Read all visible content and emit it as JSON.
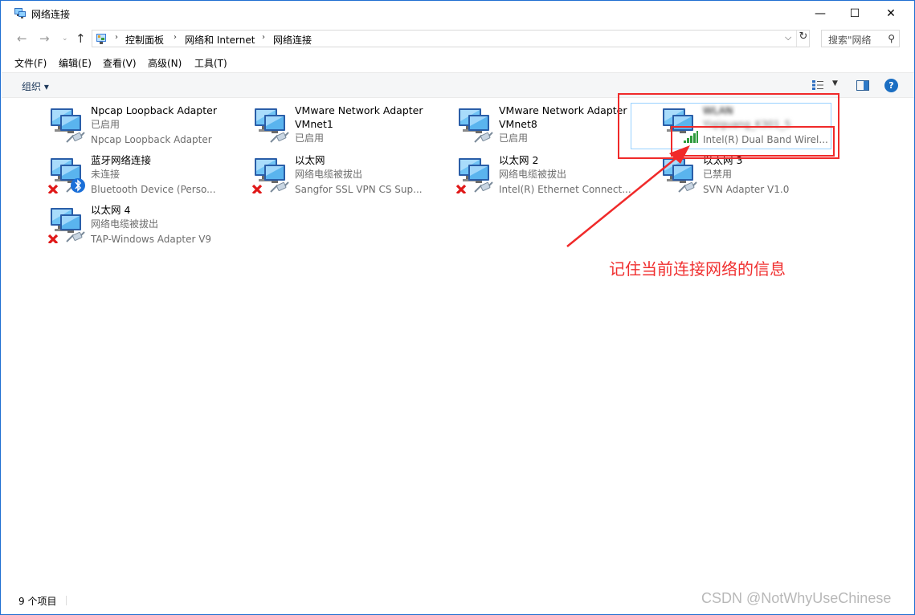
{
  "window": {
    "title": "网络连接"
  },
  "window_controls": {
    "minimize": "—",
    "maximize": "☐",
    "close": "✕"
  },
  "nav": {
    "back": "←",
    "forward": "→",
    "recent": "⌄",
    "up": "↑"
  },
  "breadcrumb": [
    "控制面板",
    "网络和 Internet",
    "网络连接"
  ],
  "search": {
    "placeholder": "搜索\"网络"
  },
  "menu": [
    "文件(F)",
    "编辑(E)",
    "查看(V)",
    "高级(N)",
    "工具(T)"
  ],
  "toolbar": {
    "organize": "组织 ▾"
  },
  "connections": [
    {
      "name": "Npcap Loopback Adapter",
      "status": "已启用",
      "device": "Npcap Loopback Adapter",
      "icon": "network-adapter-icon",
      "badge": "none"
    },
    {
      "name": "VMware Network Adapter",
      "name2": "VMnet1",
      "status": "已启用",
      "device": "",
      "icon": "network-adapter-icon",
      "badge": "none"
    },
    {
      "name": "VMware Network Adapter",
      "name2": "VMnet8",
      "status": "已启用",
      "device": "",
      "icon": "network-adapter-icon",
      "badge": "none"
    },
    {
      "name": "WLAN",
      "status": "Yiqiguang_K301_5",
      "device": "Intel(R) Dual Band Wirel...",
      "icon": "wifi-adapter-icon",
      "badge": "wifi-signal",
      "obscured": true
    },
    {
      "name": "蓝牙网络连接",
      "status": "未连接",
      "device": "Bluetooth Device (Perso...",
      "icon": "network-adapter-icon",
      "badge": "bluetooth"
    },
    {
      "name": "以太网",
      "status": "网络电缆被拔出",
      "device": "Sangfor SSL VPN CS Sup...",
      "icon": "network-adapter-icon",
      "badge": "error"
    },
    {
      "name": "以太网 2",
      "status": "网络电缆被拔出",
      "device": "Intel(R) Ethernet Connect...",
      "icon": "network-adapter-icon",
      "badge": "error"
    },
    {
      "name": "以太网 3",
      "status": "已禁用",
      "device": "SVN Adapter V1.0",
      "icon": "network-adapter-icon",
      "badge": "disabled"
    },
    {
      "name": "以太网 4",
      "status": "网络电缆被拔出",
      "device": "TAP-Windows Adapter V9",
      "icon": "network-adapter-icon",
      "badge": "error"
    }
  ],
  "annotation": {
    "text": "记住当前连接网络的信息",
    "color": "#f03030"
  },
  "statusbar": {
    "count": "9 个项目"
  },
  "watermark": "CSDN @NotWhyUseChinese",
  "colors": {
    "accent": "#1f6fd1",
    "selection": "#99d1ff",
    "annotation": "#f02a2a"
  }
}
